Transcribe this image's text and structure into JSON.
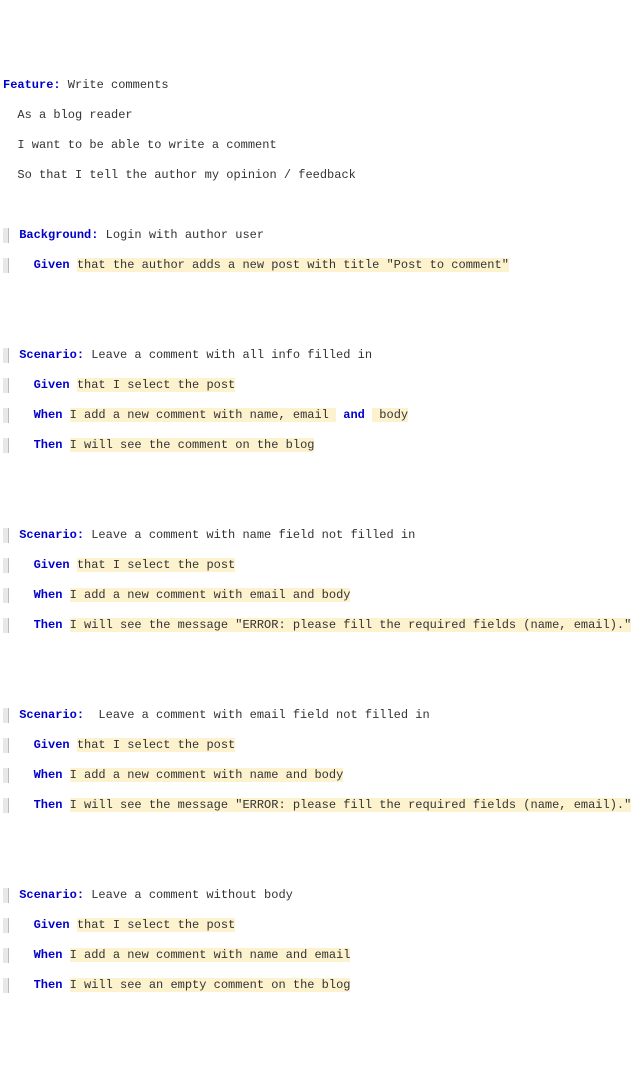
{
  "kw": {
    "feature": "Feature:",
    "background": "Background:",
    "scenario": "Scenario:",
    "given": "Given",
    "when": "When",
    "then": "Then",
    "and": "and"
  },
  "feature": {
    "title": " Write comments",
    "desc1": "  As a blog reader",
    "desc2": "  I want to be able to write a comment",
    "desc3": "  So that I tell the author my opinion / feedback"
  },
  "bg": {
    "title": " Login with author user",
    "given": "that the author adds a new post with title \"Post to comment\""
  },
  "s1": {
    "title": " Leave a comment with all info filled in",
    "given": "that I select the post",
    "when_a": "I add a new comment with name, email ",
    "when_b": " body",
    "then": "I will see the comment on the blog"
  },
  "s2": {
    "title": " Leave a comment with name field not filled in",
    "given": "that I select the post",
    "when": "I add a new comment with email and body",
    "then": "I will see the message \"ERROR: please fill the required fields (name, email).\""
  },
  "s3": {
    "title": "  Leave a comment with email field not filled in",
    "given": "that I select the post",
    "when": "I add a new comment with name and body",
    "then": "I will see the message \"ERROR: please fill the required fields (name, email).\""
  },
  "s4": {
    "title": " Leave a comment without body",
    "given": "that I select the post",
    "when": "I add a new comment with name and email",
    "then": "I will see an empty comment on the blog"
  }
}
